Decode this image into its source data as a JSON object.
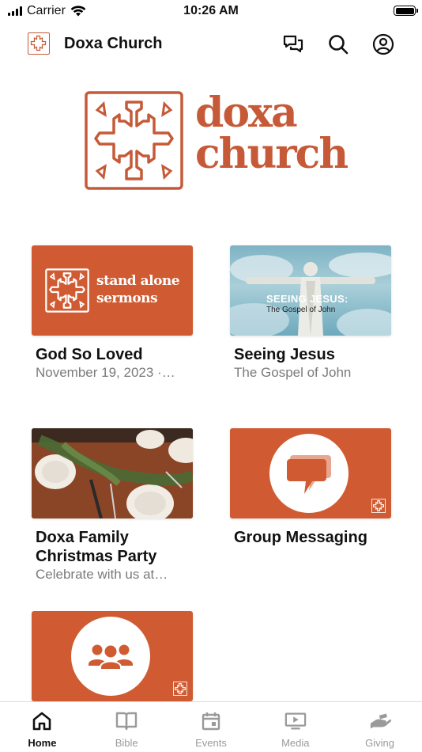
{
  "status_bar": {
    "carrier": "Carrier",
    "time": "10:26 AM",
    "battery_level": 1.0
  },
  "header": {
    "title": "Doxa Church",
    "icons": [
      "logo-mark-icon",
      "messages-icon",
      "search-icon",
      "profile-icon"
    ]
  },
  "brand": {
    "word_line1": "doxa",
    "word_line2": "church",
    "accent_color": "#c65a38",
    "tile_color": "#d05b32"
  },
  "cards": [
    {
      "thumb_line1": "stand alone",
      "thumb_line2": "sermons",
      "title": "God So Loved",
      "subtitle": "November 19, 2023 ·…"
    },
    {
      "thumb_line1": "SEEING JESUS:",
      "thumb_line2": "The Gospel of John",
      "title": "Seeing Jesus",
      "subtitle": "The Gospel of John"
    },
    {
      "title_line1": "Doxa Family",
      "title_line2": "Christmas Party",
      "subtitle": "Celebrate with us at…"
    },
    {
      "title": "Group Messaging",
      "icon": "speech-bubble-icon"
    },
    {
      "icon": "people-group-icon"
    }
  ],
  "tabs": [
    {
      "label": "Home",
      "icon": "home-icon",
      "active": true
    },
    {
      "label": "Bible",
      "icon": "book-icon",
      "active": false
    },
    {
      "label": "Events",
      "icon": "calendar-icon",
      "active": false
    },
    {
      "label": "Media",
      "icon": "media-play-icon",
      "active": false
    },
    {
      "label": "Giving",
      "icon": "giving-hand-icon",
      "active": false
    }
  ]
}
